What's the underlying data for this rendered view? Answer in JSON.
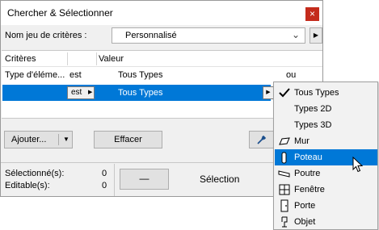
{
  "window": {
    "title": "Chercher & Sélectionner",
    "close_glyph": "×"
  },
  "criteria_set": {
    "label": "Nom jeu de critères :",
    "value": "Personnalisé"
  },
  "table": {
    "headers": {
      "criteria": "Critères",
      "value": "Valeur"
    },
    "rows": [
      {
        "criterion": "Type d'éléme...",
        "operator": "est",
        "value": "Tous Types",
        "link": "ou"
      },
      {
        "criterion": "",
        "operator": "est",
        "value": "Tous Types",
        "selected": true
      }
    ]
  },
  "buttons": {
    "add": "Ajouter...",
    "clear": "Effacer",
    "dash": "—",
    "select": "Sélection"
  },
  "stats": {
    "selected_label": "Sélectionné(s):",
    "selected_value": "0",
    "editable_label": "Editable(s):",
    "editable_value": "0"
  },
  "dropdown": {
    "items": [
      {
        "label": "Tous Types",
        "icon": "checkmark-icon",
        "checked": true
      },
      {
        "label": "Types 2D",
        "icon": ""
      },
      {
        "label": "Types 3D",
        "icon": ""
      },
      {
        "label": "Mur",
        "icon": "wall-icon"
      },
      {
        "label": "Poteau",
        "icon": "column-icon",
        "highlighted": true
      },
      {
        "label": "Poutre",
        "icon": "beam-icon"
      },
      {
        "label": "Fenêtre",
        "icon": "window-icon"
      },
      {
        "label": "Porte",
        "icon": "door-icon"
      },
      {
        "label": "Objet",
        "icon": "object-icon"
      }
    ]
  },
  "colors": {
    "selection": "#0078d7",
    "close": "#c42b1c"
  }
}
